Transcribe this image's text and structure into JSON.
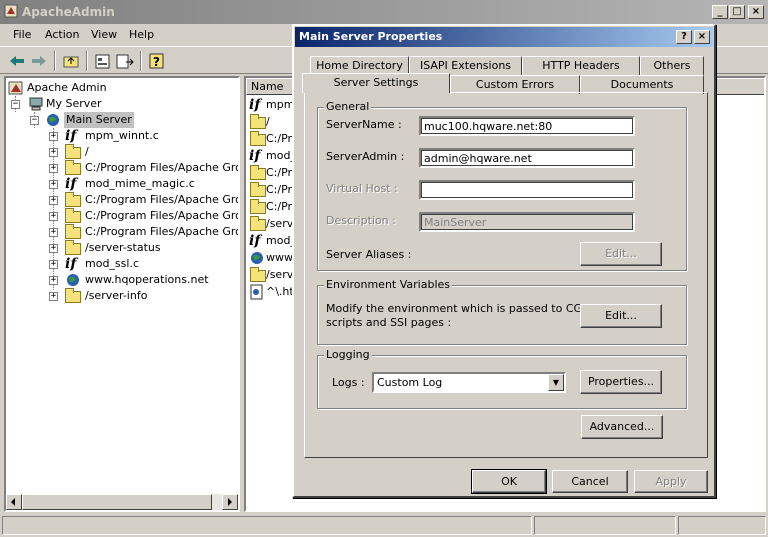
{
  "window": {
    "title": "ApacheAdmin"
  },
  "menu": [
    "File",
    "Action",
    "View",
    "Help"
  ],
  "tree": {
    "root": "Apache Admin",
    "server": "My Server",
    "main_server": "Main Server",
    "children": [
      {
        "icon": "if",
        "label": "mpm_winnt.c"
      },
      {
        "icon": "folder",
        "label": "/"
      },
      {
        "icon": "folder",
        "label": "C:/Program Files/Apache Group/"
      },
      {
        "icon": "if",
        "label": "mod_mime_magic.c"
      },
      {
        "icon": "folder",
        "label": "C:/Program Files/Apache Group/"
      },
      {
        "icon": "folder",
        "label": "C:/Program Files/Apache Group/"
      },
      {
        "icon": "folder",
        "label": "C:/Program Files/Apache Group/"
      },
      {
        "icon": "folder",
        "label": "/server-status"
      },
      {
        "icon": "if",
        "label": "mod_ssl.c"
      },
      {
        "icon": "globe",
        "label": "www.hqoperations.net"
      },
      {
        "icon": "folder",
        "label": "/server-info"
      }
    ]
  },
  "list": {
    "column": "Name",
    "items": [
      {
        "icon": "if",
        "label": "mpm_"
      },
      {
        "icon": "folder",
        "label": "/"
      },
      {
        "icon": "folder",
        "label": "C:/Pro"
      },
      {
        "icon": "if",
        "label": "mod_"
      },
      {
        "icon": "folder",
        "label": "C:/Pro"
      },
      {
        "icon": "folder",
        "label": "C:/Pro"
      },
      {
        "icon": "folder",
        "label": "C:/Pro"
      },
      {
        "icon": "folder",
        "label": "/serve"
      },
      {
        "icon": "if",
        "label": "mod_s"
      },
      {
        "icon": "globe",
        "label": "www."
      },
      {
        "icon": "folder",
        "label": "/serve"
      },
      {
        "icon": "file",
        "label": "^\\.ht"
      }
    ]
  },
  "dialog": {
    "title": "Main Server Properties",
    "help_btn": "?",
    "close_btn": "×",
    "tabs_back": [
      "Home Directory",
      "ISAPI Extensions",
      "HTTP Headers",
      "Others"
    ],
    "tabs_front": [
      "Server Settings",
      "Custom Errors",
      "Documents"
    ],
    "general": {
      "label": "General",
      "server_name_label": "ServerName :",
      "server_name": "muc100.hqware.net:80",
      "server_admin_label": "ServerAdmin :",
      "server_admin": "admin@hqware.net",
      "virtual_host_label": "Virtual Host :",
      "virtual_host": "",
      "description_label": "Description :",
      "description": "MainServer",
      "aliases_label": "Server Aliases :",
      "aliases_edit": "Edit..."
    },
    "env": {
      "label": "Environment Variables",
      "text_line1": "Modify the environment which is passed to CGI",
      "text_line2": "scripts and SSI pages  :",
      "edit": "Edit..."
    },
    "logging": {
      "label": "Logging",
      "logs_label": "Logs :",
      "logs_value": "Custom Log",
      "properties": "Properties..."
    },
    "advanced": "Advanced...",
    "ok": "OK",
    "cancel": "Cancel",
    "apply": "Apply"
  }
}
